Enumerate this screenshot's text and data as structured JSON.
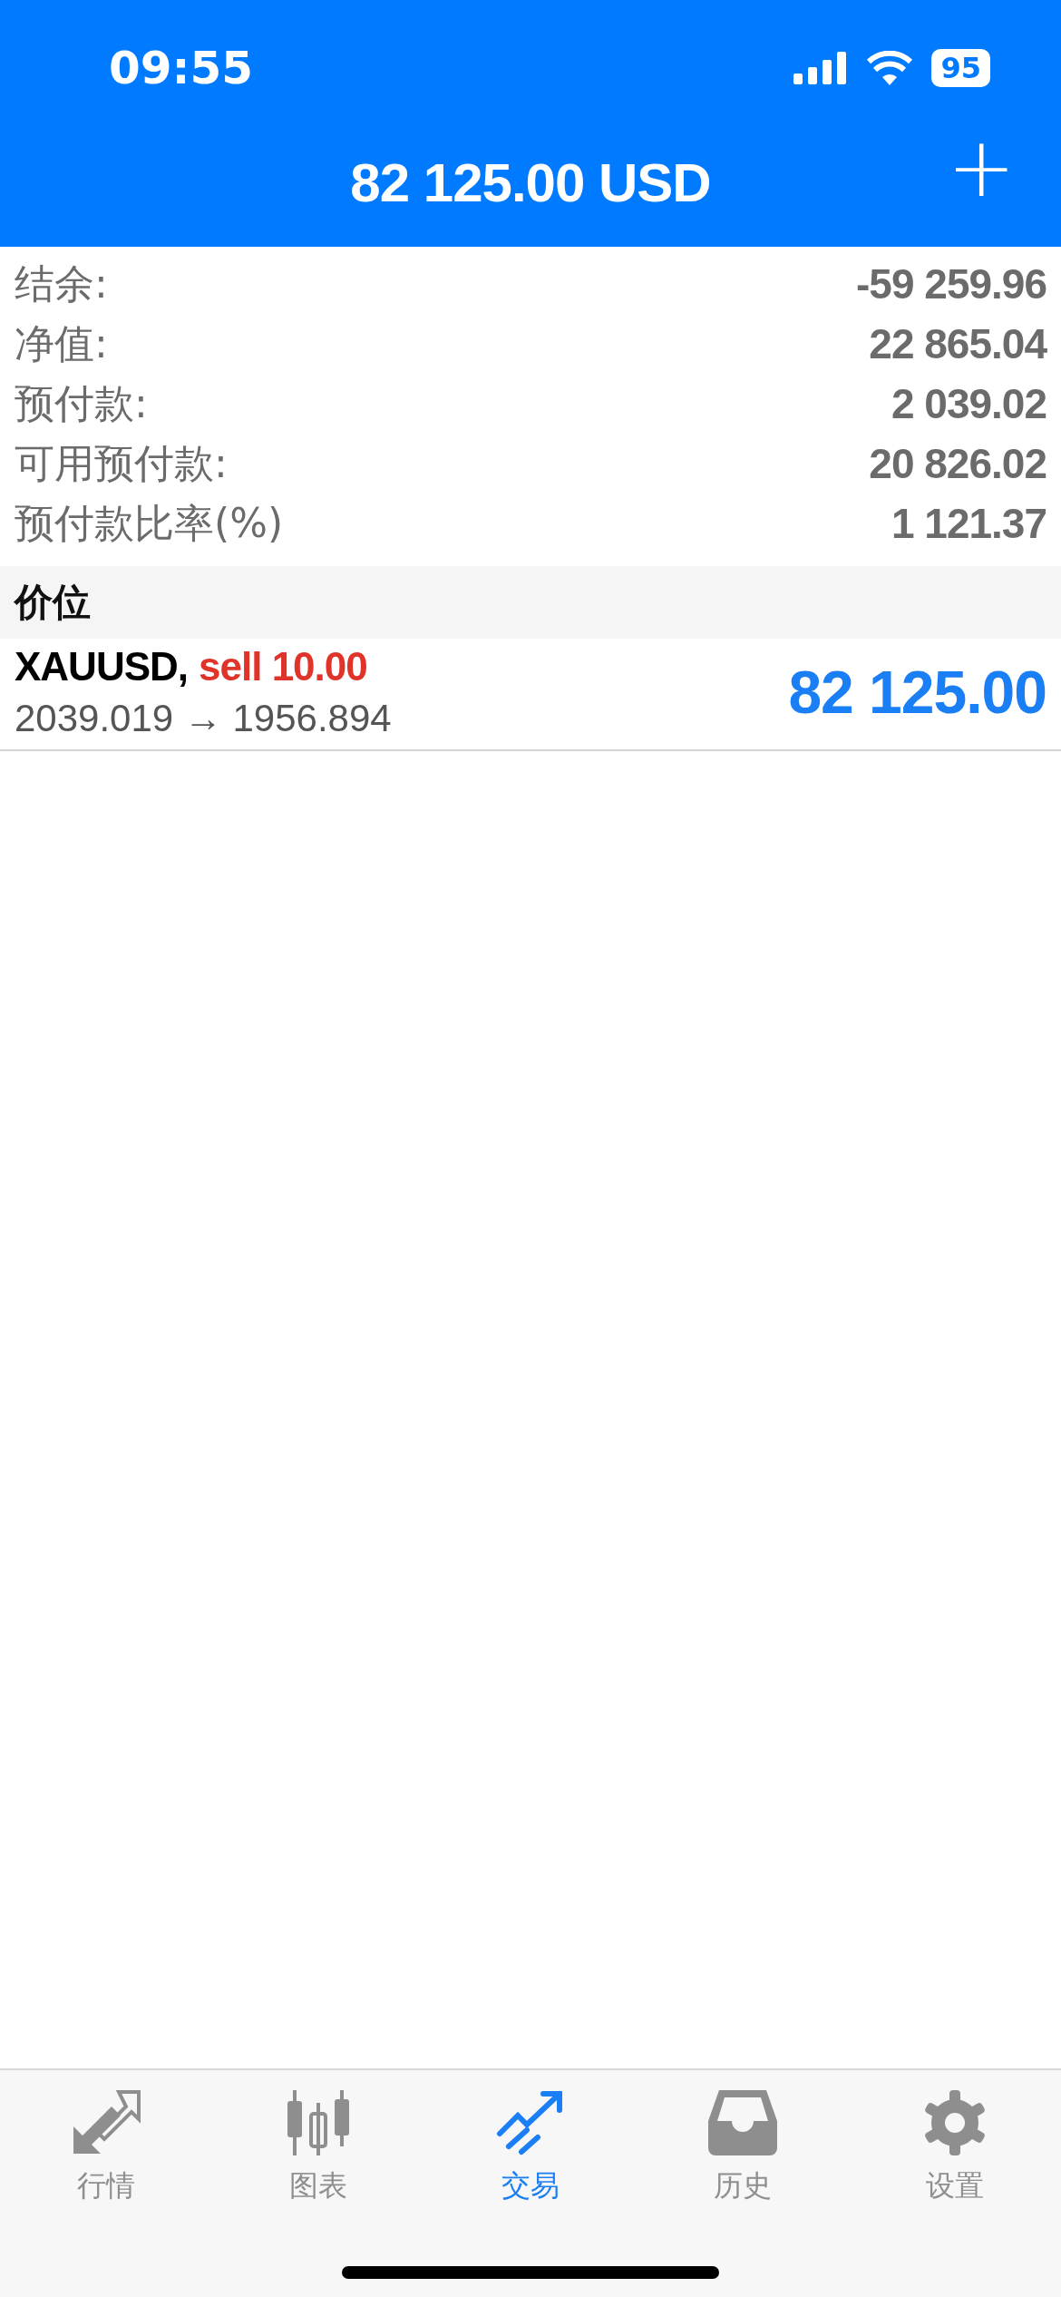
{
  "status_bar": {
    "time": "09:55",
    "battery": "95"
  },
  "header": {
    "title": "82 125.00 USD",
    "add_button": "+"
  },
  "summary": [
    {
      "label": "结余:",
      "value": "-59 259.96"
    },
    {
      "label": "净值:",
      "value": "22 865.04"
    },
    {
      "label": "预付款:",
      "value": "2 039.02"
    },
    {
      "label": "可用预付款:",
      "value": "20 826.02"
    },
    {
      "label": "预付款比率(%)",
      "value": "1 121.37"
    }
  ],
  "section_title": "价位",
  "positions": [
    {
      "symbol": "XAUUSD,",
      "side": "sell",
      "volume": "10.00",
      "prices": "2039.019 → 1956.894",
      "profit": "82 125.00"
    }
  ],
  "tabs": [
    {
      "label": "行情",
      "kind": "quotes",
      "selected": false
    },
    {
      "label": "图表",
      "kind": "chart",
      "selected": false
    },
    {
      "label": "交易",
      "kind": "trade",
      "selected": true
    },
    {
      "label": "历史",
      "kind": "history",
      "selected": false
    },
    {
      "label": "设置",
      "kind": "settings",
      "selected": false
    }
  ]
}
